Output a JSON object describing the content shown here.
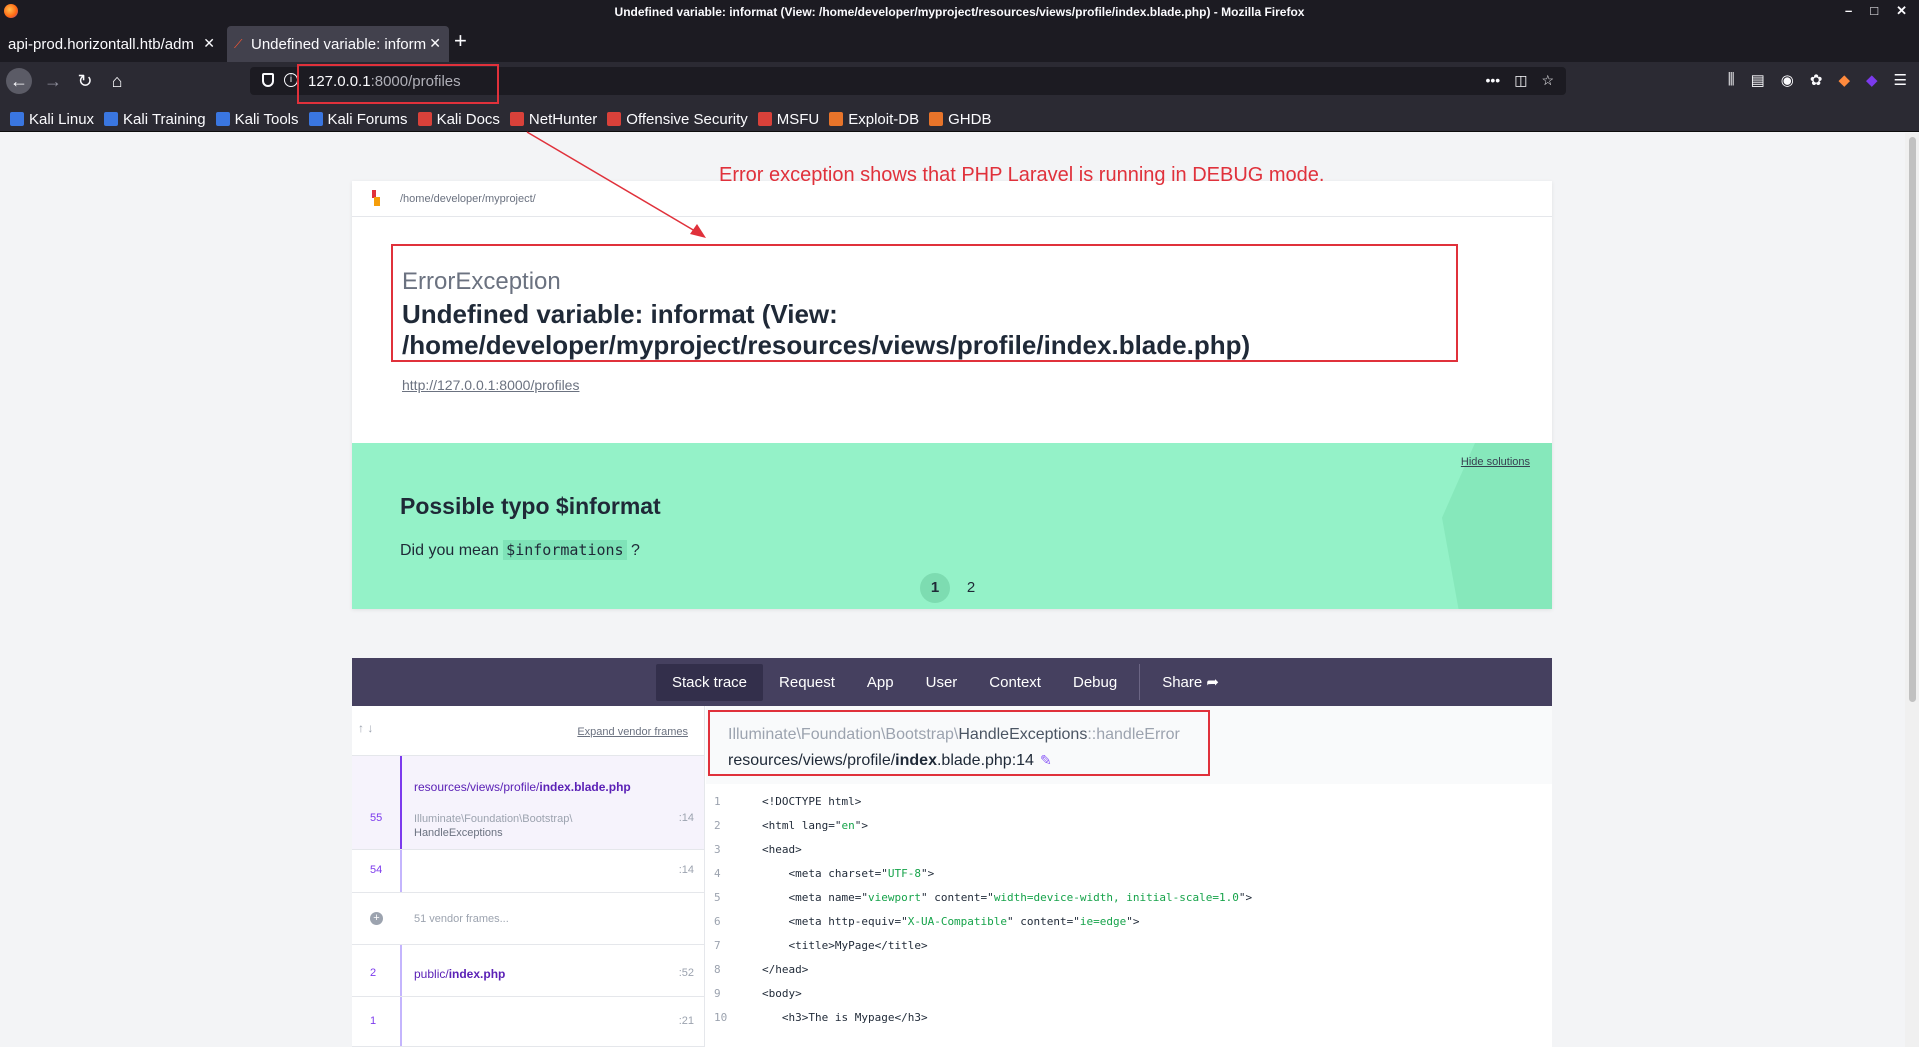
{
  "browser": {
    "window_title": "Undefined variable: informat (View: /home/developer/myproject/resources/views/profile/index.blade.php) - Mozilla Firefox",
    "tabs": [
      {
        "label": "api-prod.horizontall.htb/adm"
      },
      {
        "label": "Undefined variable: inform"
      }
    ],
    "url_host": "127.0.0.1",
    "url_rest": ":8000/profiles",
    "bookmarks": [
      {
        "label": "Kali Linux",
        "color": "#3a76e0"
      },
      {
        "label": "Kali Training",
        "color": "#3a76e0"
      },
      {
        "label": "Kali Tools",
        "color": "#3a76e0"
      },
      {
        "label": "Kali Forums",
        "color": "#3a76e0"
      },
      {
        "label": "Kali Docs",
        "color": "#d9413a"
      },
      {
        "label": "NetHunter",
        "color": "#d9413a"
      },
      {
        "label": "Offensive Security",
        "color": "#d9413a"
      },
      {
        "label": "MSFU",
        "color": "#d9413a"
      },
      {
        "label": "Exploit-DB",
        "color": "#e8742a"
      },
      {
        "label": "GHDB",
        "color": "#e8742a"
      }
    ]
  },
  "annotation": {
    "text": "Error exception shows that PHP Laravel is running in DEBUG mode."
  },
  "error_page": {
    "project_path": "/home/developer/myproject/",
    "exception_class": "ErrorException",
    "exception_message": "Undefined variable: informat (View: /home/developer/myproject/resources/views/profile/index.blade.php)",
    "request_url": "http://127.0.0.1:8000/profiles",
    "solution": {
      "hide_label": "Hide solutions",
      "title": "Possible typo $informat",
      "text_before": "Did you mean",
      "suggestion": "$informations",
      "text_after": "?",
      "pages": [
        "1",
        "2"
      ]
    },
    "tabs": [
      "Stack trace",
      "Request",
      "App",
      "User",
      "Context",
      "Debug"
    ],
    "share_label": "Share",
    "expand_vendor": "Expand vendor frames",
    "frames": [
      {
        "num": "55",
        "file_prefix": "resources/views/profile/",
        "file_bold": "index.blade.php",
        "class_line1": "Illuminate\\Foundation\\Bootstrap\\",
        "class_line2": "HandleExceptions",
        "line": ":14"
      },
      {
        "num": "54",
        "line": ":14"
      },
      {
        "vendor": "51 vendor frames..."
      },
      {
        "num": "2",
        "file_prefix": "public/",
        "file_bold": "index.php",
        "line": ":52"
      },
      {
        "num": "1",
        "line": ":21"
      }
    ],
    "selected_frame": {
      "class_prefix": "Illuminate\\Foundation\\Bootstrap\\",
      "class_name": "HandleExceptions",
      "method": "::handleError",
      "file_prefix": "resources/views/profile/",
      "file_bold": "index",
      "file_suffix": ".blade.php:14"
    },
    "code_lines": [
      {
        "n": "1",
        "code": "<!DOCTYPE html>"
      },
      {
        "n": "2",
        "code": "<html lang=\"en\">"
      },
      {
        "n": "3",
        "code": "<head>"
      },
      {
        "n": "4",
        "code": "    <meta charset=\"UTF-8\">"
      },
      {
        "n": "5",
        "code": "    <meta name=\"viewport\" content=\"width=device-width, initial-scale=1.0\">"
      },
      {
        "n": "6",
        "code": "    <meta http-equiv=\"X-UA-Compatible\" content=\"ie=edge\">"
      },
      {
        "n": "7",
        "code": "    <title>MyPage</title>"
      },
      {
        "n": "8",
        "code": "</head>"
      },
      {
        "n": "9",
        "code": "<body>"
      },
      {
        "n": "10",
        "code": "   <h3>The is Mypage</h3>"
      }
    ]
  }
}
